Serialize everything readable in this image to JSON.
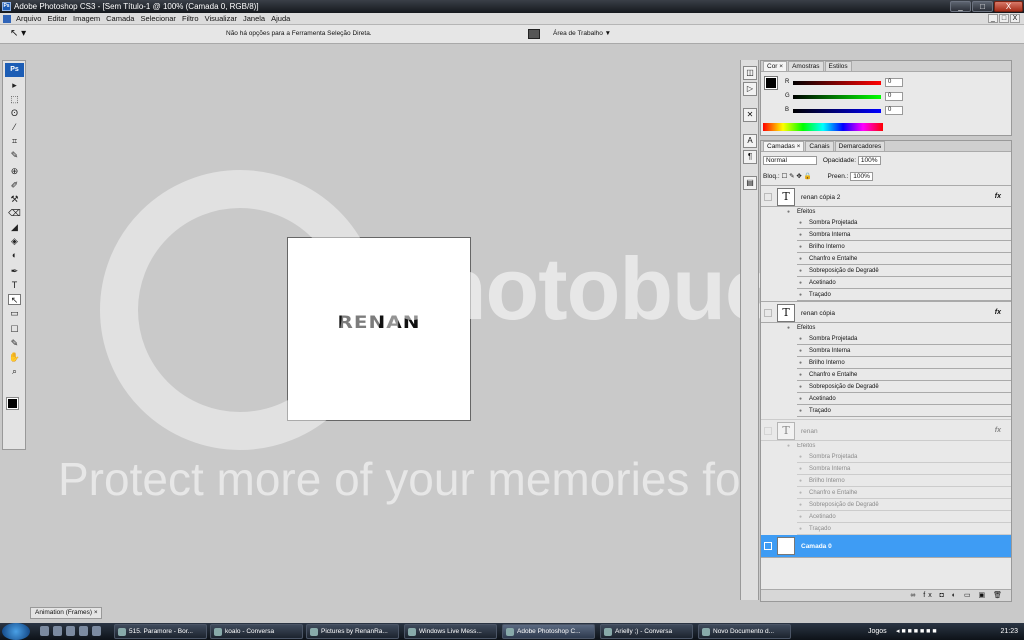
{
  "window": {
    "title": "Adobe Photoshop CS3 - [Sem Título-1 @ 100% (Camada 0, RGB/8)]",
    "app_icon": "Ps",
    "controls": [
      "_",
      "□",
      "X"
    ]
  },
  "menu": [
    "Arquivo",
    "Editar",
    "Imagem",
    "Camada",
    "Selecionar",
    "Filtro",
    "Visualizar",
    "Janela",
    "Ajuda"
  ],
  "menu_controls": [
    "_",
    "□",
    "X"
  ],
  "options_bar": {
    "hint": "Não há opções para a Ferramenta Seleção Direta.",
    "workspace": "Área de Trabalho ▼"
  },
  "toolbox": {
    "logo": "Ps",
    "tools": [
      "▸",
      "⬚",
      "ʘ",
      "⁄",
      "⌗",
      "✎",
      "⊕",
      "✐",
      "⚒",
      "⌫",
      "◢",
      "◈",
      "◐",
      "✒",
      "T",
      "↖",
      "▭",
      "☐",
      "✎",
      "✋",
      "⌕"
    ]
  },
  "canvas": {
    "text": "RENAN"
  },
  "watermark": {
    "brand": "photobucket",
    "tagline": "Protect more of your memories for less!"
  },
  "color_panel": {
    "tabs": [
      "Cor ×",
      "Amostras",
      "Estilos"
    ],
    "channels": [
      {
        "label": "R",
        "value": "0"
      },
      {
        "label": "G",
        "value": "0"
      },
      {
        "label": "B",
        "value": "0"
      }
    ]
  },
  "layers_panel": {
    "tabs": [
      "Camadas ×",
      "Canais",
      "Demarcadores"
    ],
    "blend_mode": "Normal",
    "opacity_label": "Opacidade:",
    "opacity_value": "100%",
    "lock_label": "Bloq.:",
    "fill_label": "Preen.:",
    "fill_value": "100%",
    "fx": "fx",
    "effects_header": "Efeitos",
    "effects": [
      "Sombra Projetada",
      "Sombra Interna",
      "Brilho Interno",
      "Chanfro e Entalhe",
      "Sobreposição de Degradê",
      "Acetinado",
      "Traçado"
    ],
    "layers": [
      "renan cópia 2",
      "renan cópia",
      "renan",
      "Camada 0"
    ],
    "text_thumb": "T",
    "footer_icons": "∞ fx ◘ ◐ ▭ ▣ 🗑"
  },
  "animation_panel": {
    "label": "Animation (Frames) ×"
  },
  "taskbar": {
    "items": [
      "515. Paramore - Bor...",
      "koalo - Conversa",
      "Pictures by RenanRa...",
      "Windows Live Mess...",
      "Adobe Photoshop C...",
      "Arielly ;) - Conversa",
      "Novo Documento d..."
    ],
    "jogos": "Jogos",
    "clock": "21:23"
  }
}
